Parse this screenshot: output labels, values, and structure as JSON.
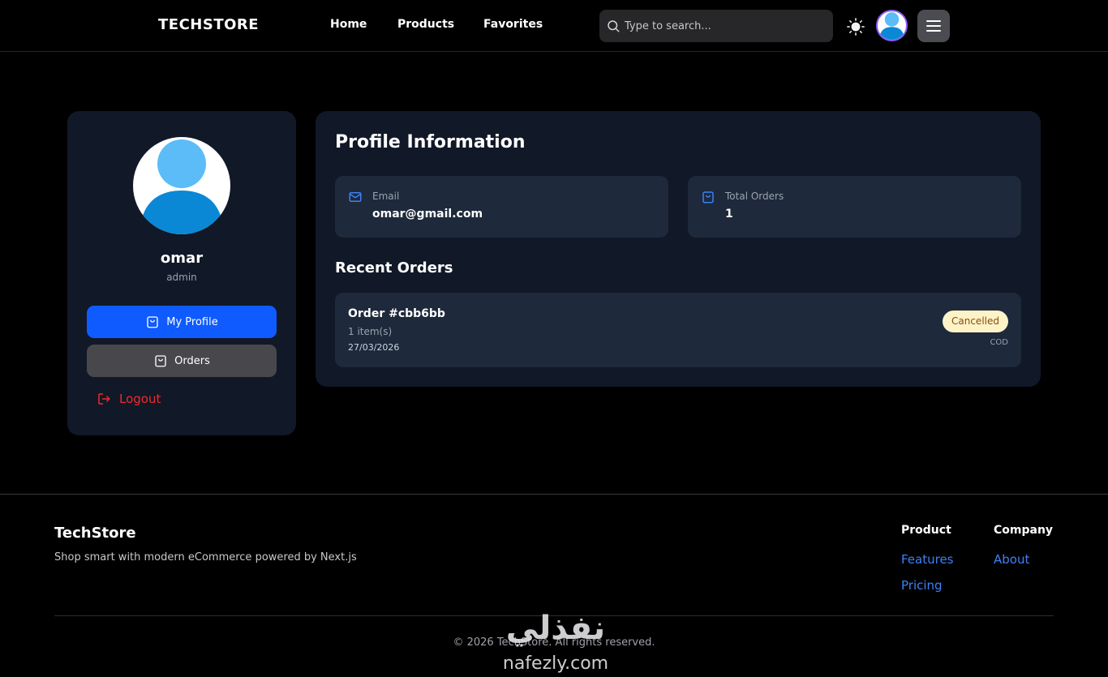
{
  "header": {
    "brand": "TECHSTORE",
    "nav": [
      {
        "label": "Home"
      },
      {
        "label": "Products"
      },
      {
        "label": "Favorites"
      }
    ],
    "search": {
      "placeholder": "Type to search..."
    }
  },
  "sidebar": {
    "username": "omar",
    "role": "admin",
    "my_profile_label": "My Profile",
    "orders_label": "Orders",
    "logout_label": "Logout"
  },
  "profile": {
    "title": "Profile Information",
    "email_label": "Email",
    "email_value": "omar@gmail.com",
    "total_orders_label": "Total Orders",
    "total_orders_value": "1",
    "recent_orders_title": "Recent Orders",
    "orders": [
      {
        "id": "Order #cbb6bb",
        "items": "1 item(s)",
        "date": "27/03/2026",
        "status": "Cancelled",
        "payment": "COD"
      }
    ]
  },
  "footer": {
    "brand": "TechStore",
    "tagline": "Shop smart with modern eCommerce powered by Next.js",
    "columns": [
      {
        "title": "Product",
        "links": [
          "Features",
          "Pricing"
        ]
      },
      {
        "title": "Company",
        "links": [
          "About"
        ]
      }
    ],
    "copyright": "© 2026 TechStore. All rights reserved."
  },
  "watermark": {
    "arabic": "نفذلي",
    "latin": "nafezly.com"
  },
  "colors": {
    "accent": "#0f5bff",
    "card": "#111827",
    "inner_card": "#1e293b",
    "danger": "#ef2b2b",
    "link": "#3b82f6",
    "status_cancelled_bg": "#fef3c7"
  }
}
